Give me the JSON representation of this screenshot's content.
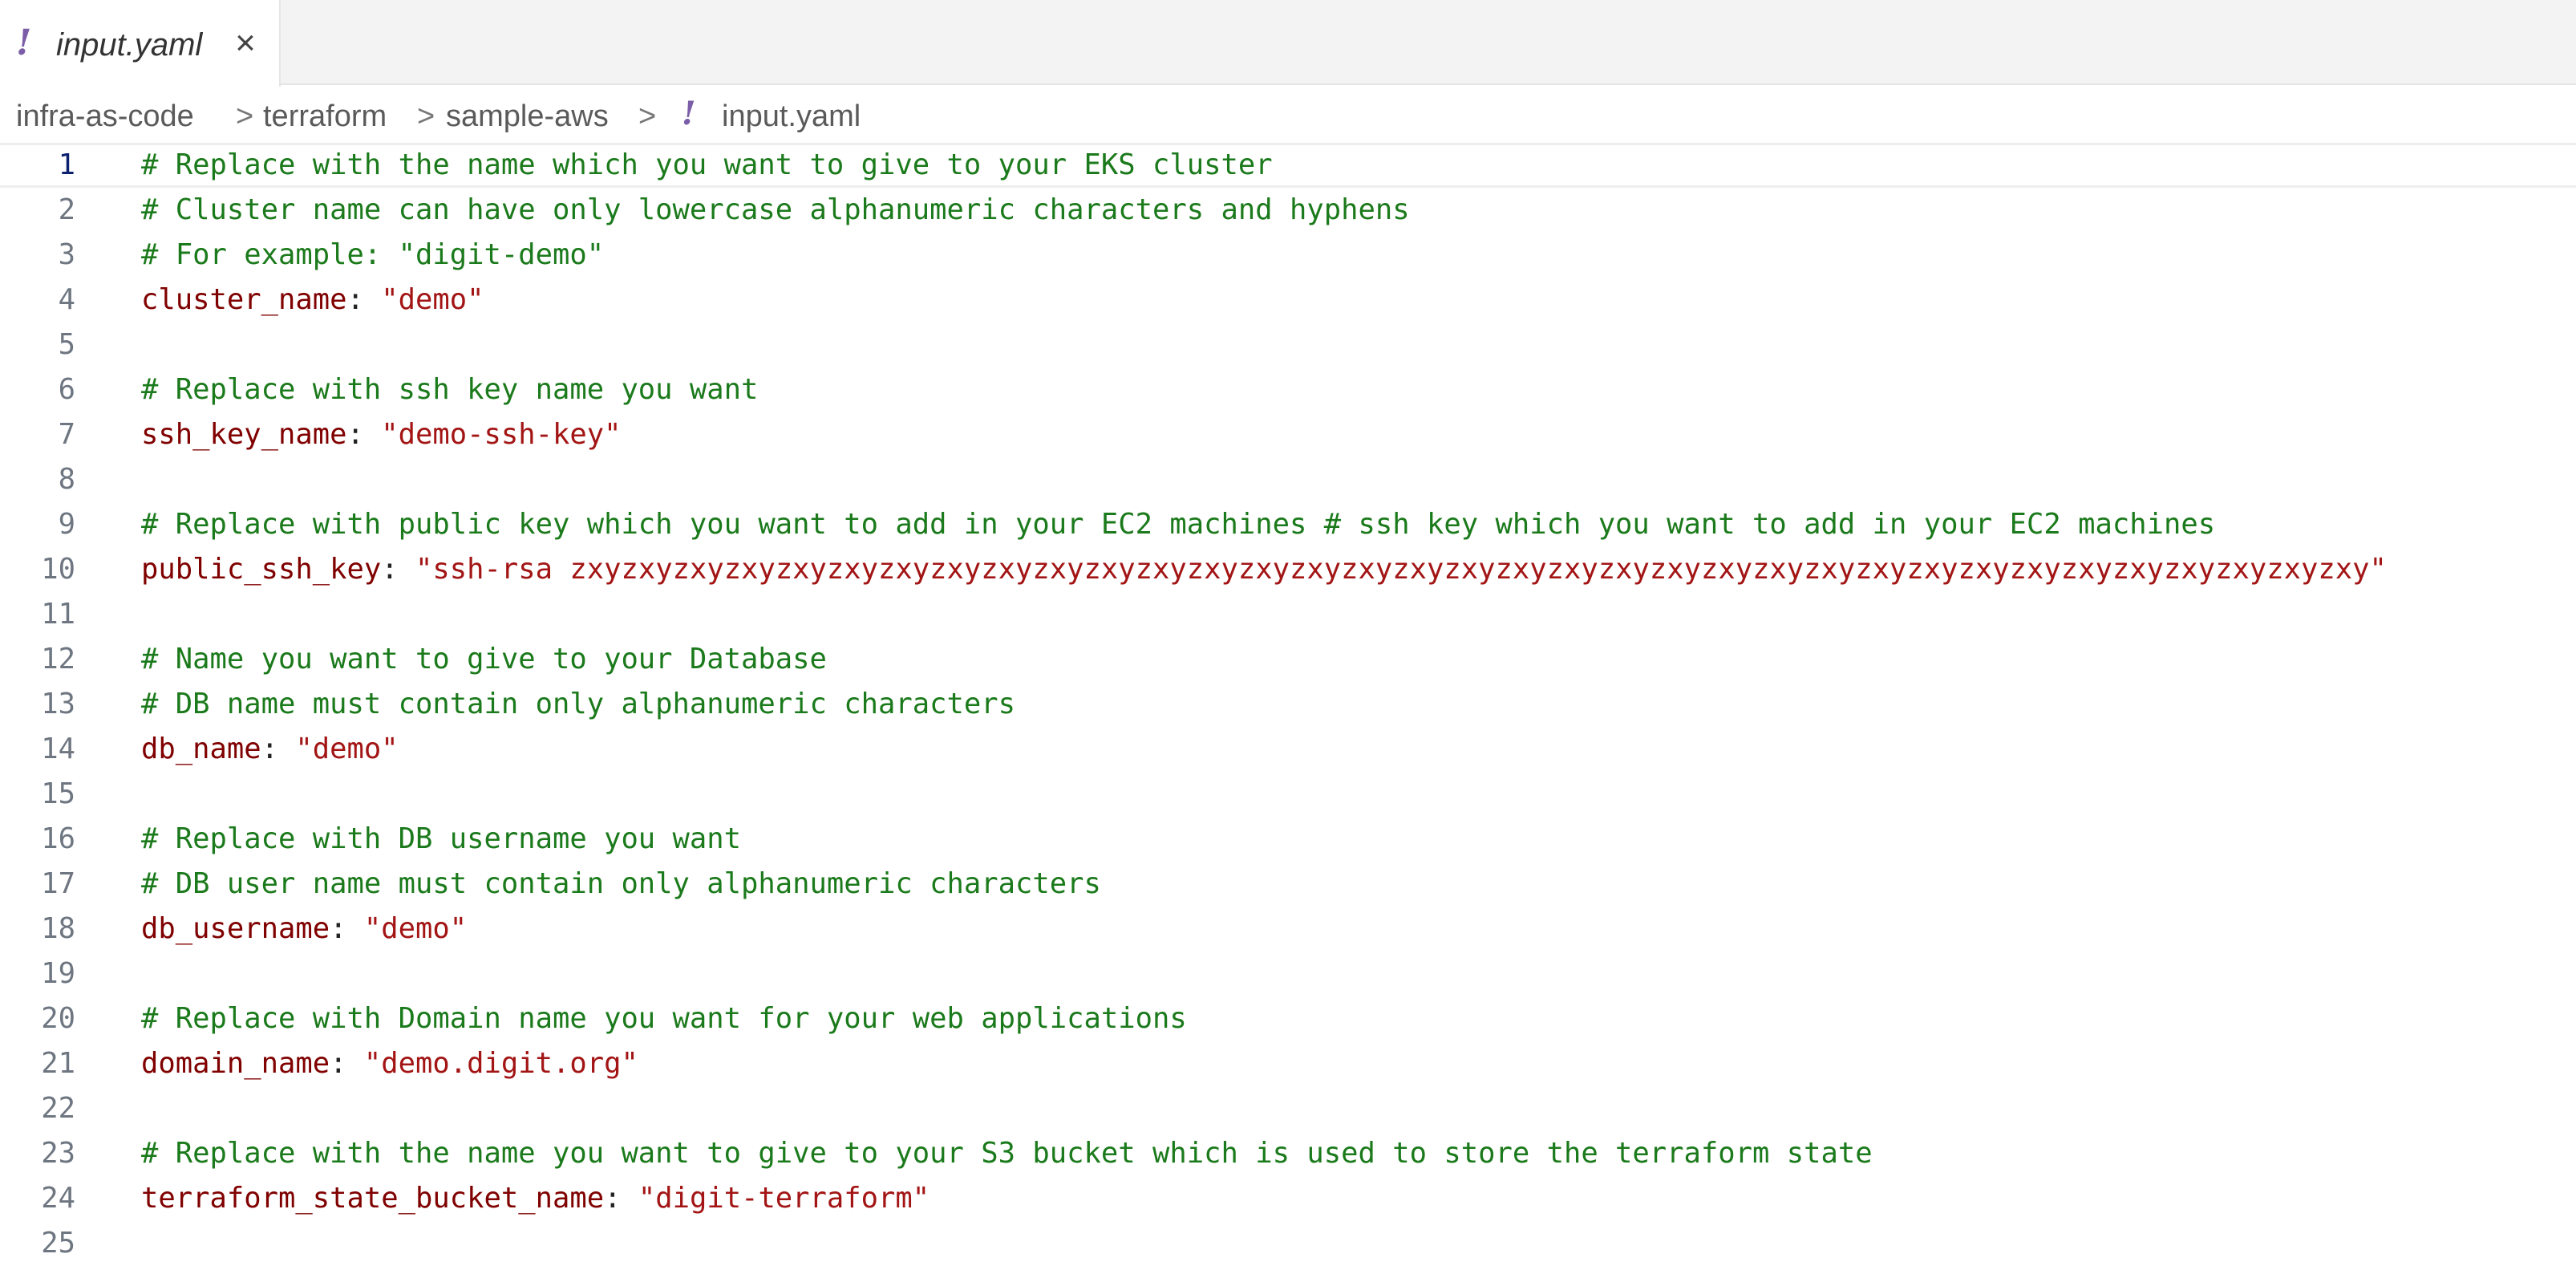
{
  "tab": {
    "label": "input.yaml",
    "yaml_icon": "!",
    "close_icon": "×"
  },
  "breadcrumb": {
    "items": [
      "infra-as-code",
      "terraform",
      "sample-aws",
      "input.yaml"
    ],
    "separator": ">",
    "yaml_icon": "!"
  },
  "editor": {
    "current_line": 1,
    "lines": [
      {
        "n": "1",
        "comment": "# Replace with the name which you want to give to your EKS cluster"
      },
      {
        "n": "2",
        "comment": "# Cluster name can have only lowercase alphanumeric characters and hyphens"
      },
      {
        "n": "3",
        "comment": "# For example: \"digit-demo\""
      },
      {
        "n": "4",
        "key": "cluster_name",
        "value": "\"demo\""
      },
      {
        "n": "5"
      },
      {
        "n": "6",
        "comment": "# Replace with ssh key name you want"
      },
      {
        "n": "7",
        "key": "ssh_key_name",
        "value": "\"demo-ssh-key\""
      },
      {
        "n": "8"
      },
      {
        "n": "9",
        "comment": "# Replace with public key which you want to add in your EC2 machines # ssh key which you want to add in your EC2 machines"
      },
      {
        "n": "10",
        "key": "public_ssh_key",
        "value": "\"ssh-rsa zxyzxyzxyzxyzxyzxyzxyzxyzxyzxyzxyzxyzxyzxyzxyzxyzxyzxyzxyzxyzxyzxyzxyzxyzxyzxyzxyzxyzxyzxyzxyzxyzxyzxyzxy\""
      },
      {
        "n": "11"
      },
      {
        "n": "12",
        "comment": "# Name you want to give to your Database"
      },
      {
        "n": "13",
        "comment": "# DB name must contain only alphanumeric characters"
      },
      {
        "n": "14",
        "key": "db_name",
        "value": "\"demo\""
      },
      {
        "n": "15"
      },
      {
        "n": "16",
        "comment": "# Replace with DB username you want"
      },
      {
        "n": "17",
        "comment": "# DB user name must contain only alphanumeric characters"
      },
      {
        "n": "18",
        "key": "db_username",
        "value": "\"demo\""
      },
      {
        "n": "19"
      },
      {
        "n": "20",
        "comment": "# Replace with Domain name you want for your web applications"
      },
      {
        "n": "21",
        "key": "domain_name",
        "value": "\"demo.digit.org\""
      },
      {
        "n": "22"
      },
      {
        "n": "23",
        "comment": "# Replace with the name you want to give to your S3 bucket which is used to store the terraform state"
      },
      {
        "n": "24",
        "key": "terraform_state_bucket_name",
        "value": "\"digit-terraform\""
      },
      {
        "n": "25"
      }
    ]
  },
  "colors": {
    "comment": "#1b7a1b",
    "key": "#800000",
    "string": "#a31515",
    "line_number": "#6e7681",
    "active_line_number": "#0b216f",
    "yaml_icon": "#7b5ea7"
  }
}
